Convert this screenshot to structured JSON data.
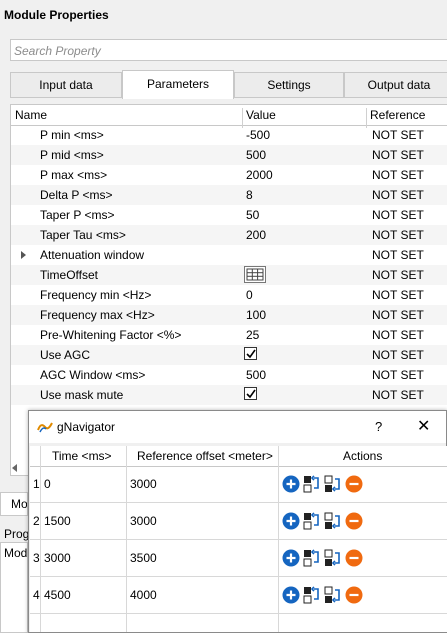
{
  "panel_title": "Module Properties",
  "search": {
    "placeholder": "Search Property"
  },
  "tabs": [
    {
      "label": "Input data",
      "active": false
    },
    {
      "label": "Parameters",
      "active": true
    },
    {
      "label": "Settings",
      "active": false
    },
    {
      "label": "Output data",
      "active": false
    }
  ],
  "grid": {
    "columns": {
      "name": "Name",
      "value": "Value",
      "reference": "Reference"
    },
    "rows": [
      {
        "name": "P min <ms>",
        "value": "-500",
        "reference": "NOT SET"
      },
      {
        "name": "P mid <ms>",
        "value": "500",
        "reference": "NOT SET"
      },
      {
        "name": "P max <ms>",
        "value": "2000",
        "reference": "NOT SET"
      },
      {
        "name": "Delta P <ms>",
        "value": "8",
        "reference": "NOT SET"
      },
      {
        "name": "Taper P <ms>",
        "value": "50",
        "reference": "NOT SET"
      },
      {
        "name": "Taper Tau <ms>",
        "value": "200",
        "reference": "NOT SET"
      },
      {
        "name": "Attenuation window",
        "value": "",
        "reference": "NOT SET",
        "expandable": true
      },
      {
        "name": "TimeOffset",
        "value": "",
        "reference": "NOT SET",
        "icon": "table-icon"
      },
      {
        "name": "Frequency min <Hz>",
        "value": "0",
        "reference": "NOT SET"
      },
      {
        "name": "Frequency max <Hz>",
        "value": "100",
        "reference": "NOT SET"
      },
      {
        "name": "Pre-Whitening Factor <%>",
        "value": "25",
        "reference": "NOT SET"
      },
      {
        "name": "Use AGC",
        "value": "",
        "reference": "NOT SET",
        "checked": true
      },
      {
        "name": "AGC Window <ms>",
        "value": "500",
        "reference": "NOT SET"
      },
      {
        "name": "Use mask mute",
        "value": "",
        "reference": "NOT SET",
        "checked": true
      }
    ]
  },
  "bottom": {
    "tab_label": "Module",
    "section_label": "Prog",
    "panel_text": "Mod"
  },
  "dialog": {
    "title": "gNavigator",
    "help": "?",
    "close": "✕",
    "columns": {
      "time": "Time <ms>",
      "offset": "Reference offset <meter>",
      "actions": "Actions"
    },
    "rows": [
      {
        "index": "1",
        "time": "0",
        "offset": "3000"
      },
      {
        "index": "2",
        "time": "1500",
        "offset": "3000"
      },
      {
        "index": "3",
        "time": "3000",
        "offset": "3500"
      },
      {
        "index": "4",
        "time": "4500",
        "offset": "4000"
      }
    ],
    "action_icons": [
      "add-icon",
      "insert-above-icon",
      "insert-below-icon",
      "remove-icon"
    ]
  },
  "colors": {
    "add": "#1565c0",
    "remove": "#f06a10",
    "accent_logo": "#e08a00"
  }
}
